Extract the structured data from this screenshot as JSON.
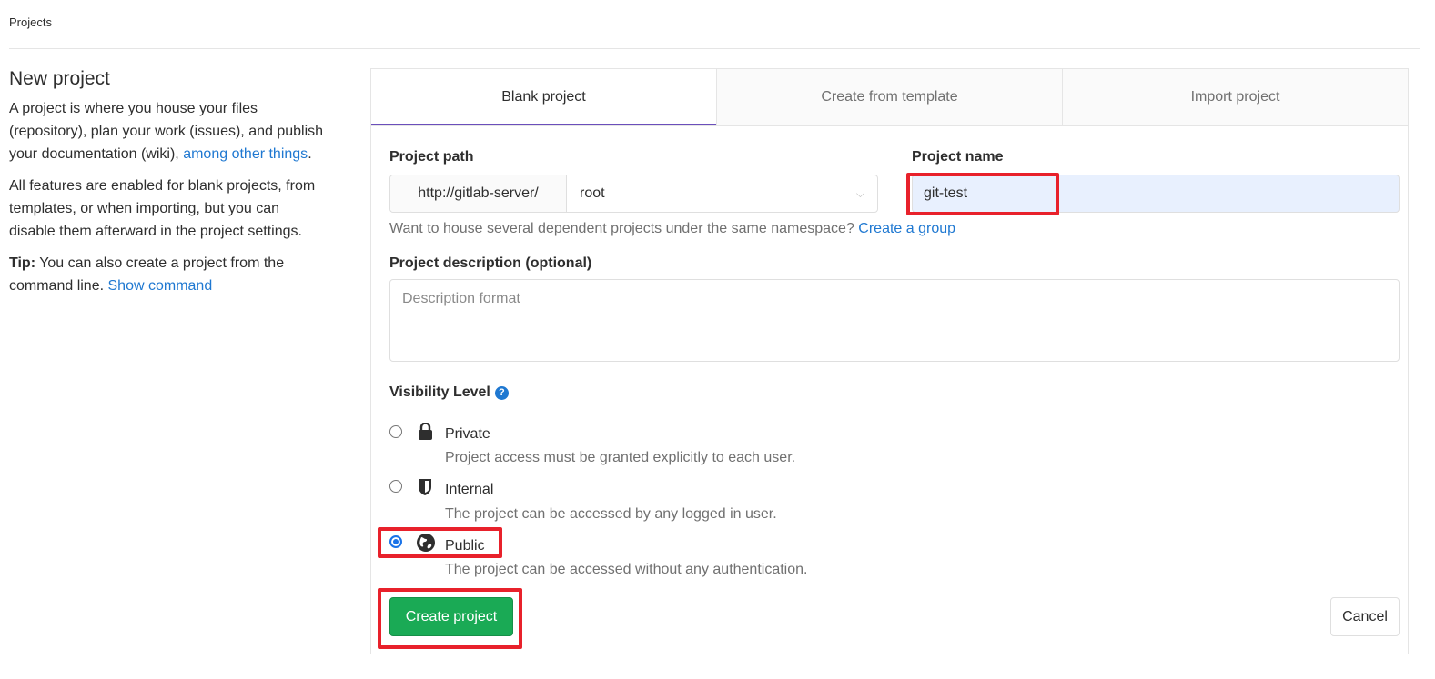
{
  "breadcrumb": "Projects",
  "sidebar": {
    "title": "New project",
    "desc1": "A project is where you house your files (repository), plan your work (issues), and publish your documentation (wiki),",
    "desc1_link": "among other things",
    "desc2": "All features are enabled for blank projects, from templates, or when importing, but you can disable them afterward in the project settings.",
    "tip_label": "Tip:",
    "tip_text": "You can also create a project from the command line.",
    "tip_link": "Show command"
  },
  "tabs": [
    {
      "label": "Blank project",
      "active": true
    },
    {
      "label": "Create from template"
    },
    {
      "label": "Import project"
    }
  ],
  "form": {
    "path_label": "Project path",
    "path_prefix": "http://gitlab-server/",
    "namespace": "root",
    "name_label": "Project name",
    "name_value": "git-test",
    "group_help": "Want to house several dependent projects under the same namespace?",
    "group_link": "Create a group",
    "desc_label": "Project description (optional)",
    "desc_placeholder": "Description format",
    "visibility_label": "Visibility Level",
    "visibility": [
      {
        "label": "Private",
        "desc": "Project access must be granted explicitly to each user.",
        "icon": "lock-icon",
        "checked": false
      },
      {
        "label": "Internal",
        "desc": "The project can be accessed by any logged in user.",
        "icon": "shield-icon",
        "checked": false
      },
      {
        "label": "Public",
        "desc": "The project can be accessed without any authentication.",
        "icon": "globe-icon",
        "checked": true
      }
    ],
    "create_label": "Create project",
    "cancel_label": "Cancel"
  },
  "colors": {
    "accent": "#6b4fbb",
    "primary_button": "#1aaa55",
    "link": "#1f78d1",
    "annotation": "#e8212b"
  }
}
